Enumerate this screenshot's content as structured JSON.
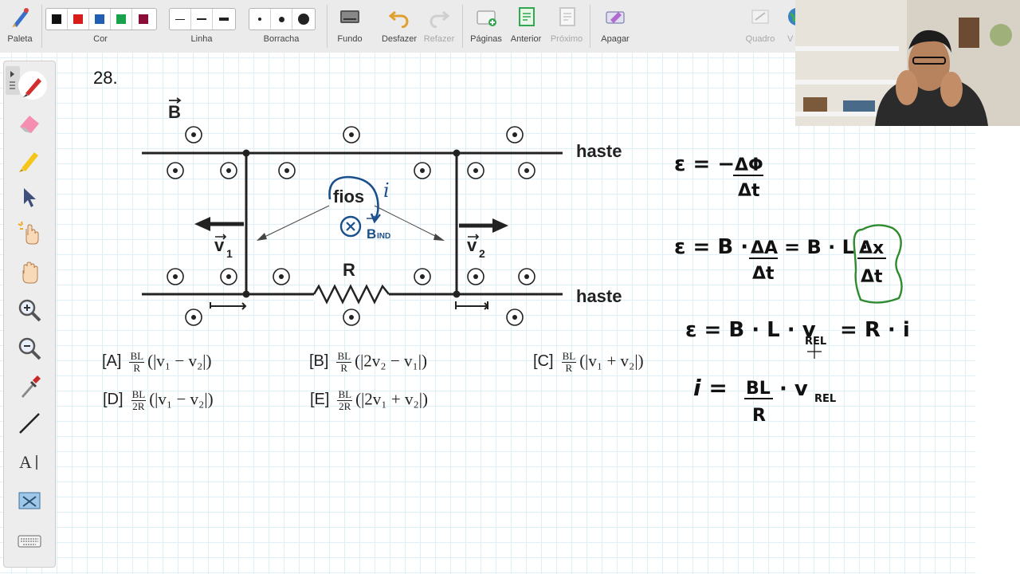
{
  "toolbar": {
    "palette": "Paleta",
    "color": "Cor",
    "line": "Linha",
    "eraser": "Borracha",
    "background": "Fundo",
    "undo": "Desfazer",
    "redo": "Refazer",
    "pages": "Páginas",
    "previous": "Anterior",
    "next": "Próximo",
    "erase": "Apagar",
    "frame": "Quadro",
    "cut_label": "V",
    "colors": [
      "#111111",
      "#d81b1b",
      "#1f5fb4",
      "#16a34a",
      "#8b0d3a"
    ]
  },
  "question": {
    "number": "28.",
    "figure": {
      "field": "B",
      "haste_top": "haste",
      "haste_bottom": "haste",
      "fios": "fios",
      "current": "i",
      "v1": "v",
      "v1_sub": "1",
      "v2": "v",
      "v2_sub": "2",
      "resistor": "R",
      "induced": "B",
      "induced_sub": "IND"
    },
    "options": [
      {
        "tag": "[A]",
        "num": "BL",
        "den": "R",
        "expr": "(|v₁ − v₂|)"
      },
      {
        "tag": "[B]",
        "num": "BL",
        "den": "R",
        "expr": "(|2v₂ − v₁|)"
      },
      {
        "tag": "[C]",
        "num": "BL",
        "den": "R",
        "expr": "(|v₁ + v₂|)"
      },
      {
        "tag": "[D]",
        "num": "BL",
        "den": "2R",
        "expr": "(|v₁ − v₂|)"
      },
      {
        "tag": "[E]",
        "num": "BL",
        "den": "2R",
        "expr": "(|2v₁ + v₂|)"
      }
    ]
  },
  "notes": {
    "eq1_lhs": "ε = −",
    "eq1_num": "ΔΦ",
    "eq1_den": "Δt",
    "eq2_lhs": "ε = B ·",
    "eq2_num": "ΔA",
    "eq2_den": "Δt",
    "eq2_mid": "= B · L ·",
    "eq2_num2": "Δx",
    "eq2_den2": "Δt",
    "eq3": "ε = B · L · v",
    "eq3_sub": "REL",
    "eq3_rhs": "= R · i",
    "eq4_lhs": "i =",
    "eq4_num": "BL",
    "eq4_den": "R",
    "eq4_rhs": "· v",
    "eq4_sub": "REL"
  }
}
